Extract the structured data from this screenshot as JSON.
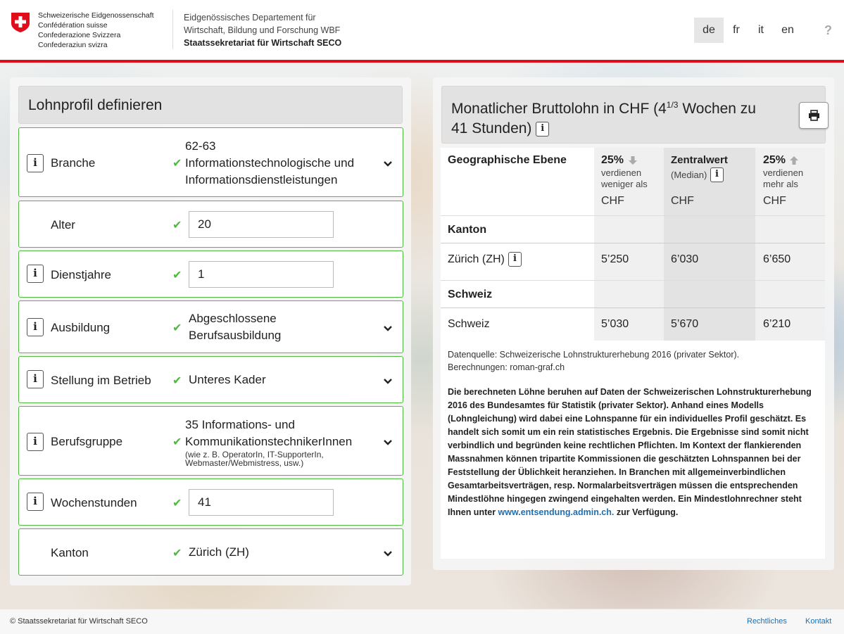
{
  "header": {
    "confederation": [
      "Schweizerische Eidgenossenschaft",
      "Confédération suisse",
      "Confederazione Svizzera",
      "Confederaziun svizra"
    ],
    "department_line1": "Eidgenössisches Departement für",
    "department_line2": "Wirtschaft, Bildung und Forschung WBF",
    "secretariat": "Staatssekretariat für Wirtschaft SECO",
    "languages": [
      "de",
      "fr",
      "it",
      "en"
    ],
    "active_language": "de",
    "help_label": "?",
    "accent_color": "#e00d1a"
  },
  "left": {
    "title": "Lohnprofil definieren",
    "fields": {
      "branche": {
        "label": "Branche",
        "value_line1": "62-63",
        "value_line2": "Informationstechnologische und",
        "value_line3": "Informationsdienstleistungen"
      },
      "alter": {
        "label": "Alter",
        "value": "20"
      },
      "dienstjahre": {
        "label": "Dienstjahre",
        "value": "1"
      },
      "ausbildung": {
        "label": "Ausbildung",
        "value_line1": "Abgeschlossene",
        "value_line2": "Berufsausbildung"
      },
      "stellung": {
        "label": "Stellung im Betrieb",
        "value": "Unteres Kader"
      },
      "berufsgruppe": {
        "label": "Berufsgruppe",
        "value_line1": "35 Informations- und",
        "value_line2": "KommunikationstechnikerInnen",
        "sub_line1": "(wie z. B. OperatorIn, IT-SupporterIn,",
        "sub_line2": "Webmaster/Webmistress, usw.)"
      },
      "wochenstunden": {
        "label": "Wochenstunden",
        "value": "41"
      },
      "kanton": {
        "label": "Kanton",
        "value": "Zürich (ZH)"
      }
    },
    "valid_color": "#4dbb3d"
  },
  "right": {
    "title_part1": "Monatlicher Bruttolohn in CHF (4",
    "title_sup": "1/3",
    "title_part2": " Wochen zu",
    "title_line2": "41 Stunden)",
    "info_glyph": "i",
    "table": {
      "col_geo": "Geographische Ebene",
      "col_low_pct": "25%",
      "col_low_desc1": "verdienen",
      "col_low_desc2": "weniger als",
      "col_median": "Zentralwert",
      "col_median_sub": "(Median)",
      "col_high_pct": "25%",
      "col_high_desc1": "verdienen",
      "col_high_desc2": "mehr als",
      "currency": "CHF",
      "section_kanton": "Kanton",
      "row_kanton": {
        "name": "Zürich (ZH)",
        "low": "5’250",
        "median": "6’030",
        "high": "6’650"
      },
      "section_schweiz": "Schweiz",
      "row_schweiz": {
        "name": "Schweiz",
        "low": "5’030",
        "median": "5’670",
        "high": "6’210"
      }
    },
    "source_line1": "Datenquelle: Schweizerische Lohnstrukturerhebung 2016 (privater Sektor).",
    "source_line2": "Berechnungen: roman-graf.ch",
    "disclaimer_text": "Die berechneten Löhne beruhen auf Daten der Schweizerischen Lohnstrukturerhebung 2016 des Bundesamtes für Statistik (privater Sektor). Anhand eines Modells (Lohngleichung) wird dabei eine Lohnspanne für ein individuelles Profil geschätzt. Es handelt sich somit um ein rein statistisches Ergebnis. Die Ergebnisse sind somit nicht verbindlich und begründen keine rechtlichen Pflichten. Im Kontext der flankierenden Massnahmen können tripartite Kommissionen die geschätzten Lohnspannen bei der Feststellung der Üblichkeit heranziehen. In Branchen mit allgemeinverbindlichen Gesamtarbeitsverträgen, resp. Normalarbeitsverträgen müssen die entsprechenden Mindestlöhne hingegen zwingend eingehalten werden. Ein Mindestlohnrechner steht Ihnen unter",
    "disclaimer_link": "www.entsendung.admin.ch.",
    "disclaimer_end": " zur Verfügung.",
    "link_color": "#1f6fb0"
  },
  "footer": {
    "copyright": "© Staatssekretariat für Wirtschaft SECO",
    "link_legal": "Rechtliches",
    "link_contact": "Kontakt"
  }
}
